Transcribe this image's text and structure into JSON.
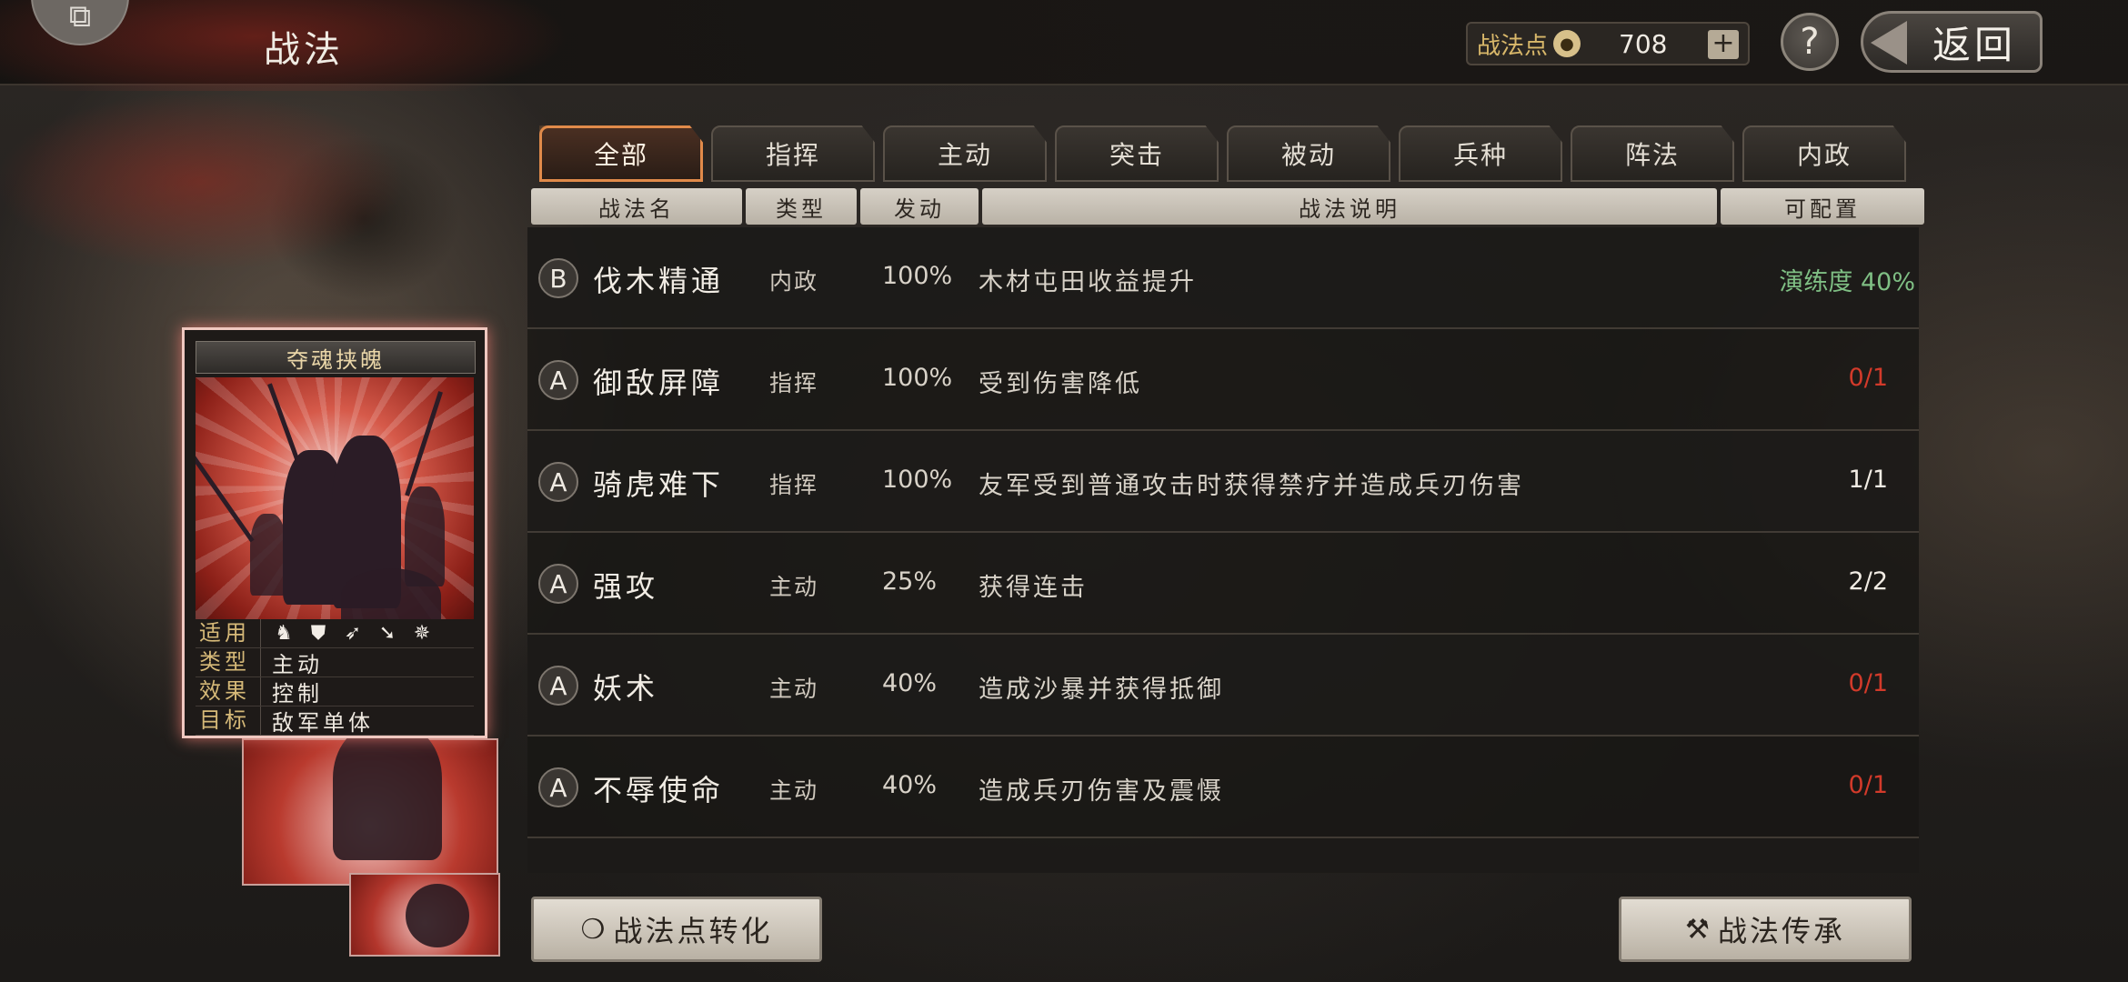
{
  "header": {
    "corner_icon": "puzzle-icon",
    "title": "战法",
    "points_label": "战法点",
    "points_icon": "coin-icon",
    "points_value": "708",
    "plus_label": "+",
    "help_label": "?",
    "back_label": "返回"
  },
  "tabs": [
    {
      "label": "全部",
      "active": true
    },
    {
      "label": "指挥"
    },
    {
      "label": "主动"
    },
    {
      "label": "突击"
    },
    {
      "label": "被动"
    },
    {
      "label": "兵种"
    },
    {
      "label": "阵法"
    },
    {
      "label": "内政"
    }
  ],
  "columns": {
    "name": "战法名",
    "type": "类型",
    "rate": "发动",
    "desc": "战法说明",
    "config": "可配置"
  },
  "rows": [
    {
      "grade": "B",
      "name": "伐木精通",
      "type": "内政",
      "rate": "100%",
      "desc": "木材屯田收益提升",
      "config": "演练度 40%",
      "config_color": "#7fbf84"
    },
    {
      "grade": "A",
      "name": "御敌屏障",
      "type": "指挥",
      "rate": "100%",
      "desc": "受到伤害降低",
      "config": "0/1",
      "config_color": "#d23a2a"
    },
    {
      "grade": "A",
      "name": "骑虎难下",
      "type": "指挥",
      "rate": "100%",
      "desc": "友军受到普通攻击时获得禁疗并造成兵刃伤害",
      "config": "1/1",
      "config_color": "#f1ece4"
    },
    {
      "grade": "A",
      "name": "强攻",
      "type": "主动",
      "rate": "25%",
      "desc": "获得连击",
      "config": "2/2",
      "config_color": "#f1ece4"
    },
    {
      "grade": "A",
      "name": "妖术",
      "type": "主动",
      "rate": "40%",
      "desc": "造成沙暴并获得抵御",
      "config": "0/1",
      "config_color": "#d23a2a"
    },
    {
      "grade": "A",
      "name": "不辱使命",
      "type": "主动",
      "rate": "40%",
      "desc": "造成兵刃伤害及震慑",
      "config": "0/1",
      "config_color": "#d23a2a"
    }
  ],
  "card": {
    "title": "夺魂挟魄",
    "apply_label": "适用",
    "unit_icons": [
      "cavalry-icon",
      "shield-icon",
      "bow-icon",
      "spear-icon",
      "wheel-icon"
    ],
    "type_label": "类型",
    "type_value": "主动",
    "effect_label": "效果",
    "effect_value": "控制",
    "target_label": "目标",
    "target_value": "敌军单体"
  },
  "buttons": {
    "convert_icon": "coin-icon",
    "convert_label": "战法点转化",
    "inherit_icon": "hammer-icon",
    "inherit_label": "战法传承"
  }
}
